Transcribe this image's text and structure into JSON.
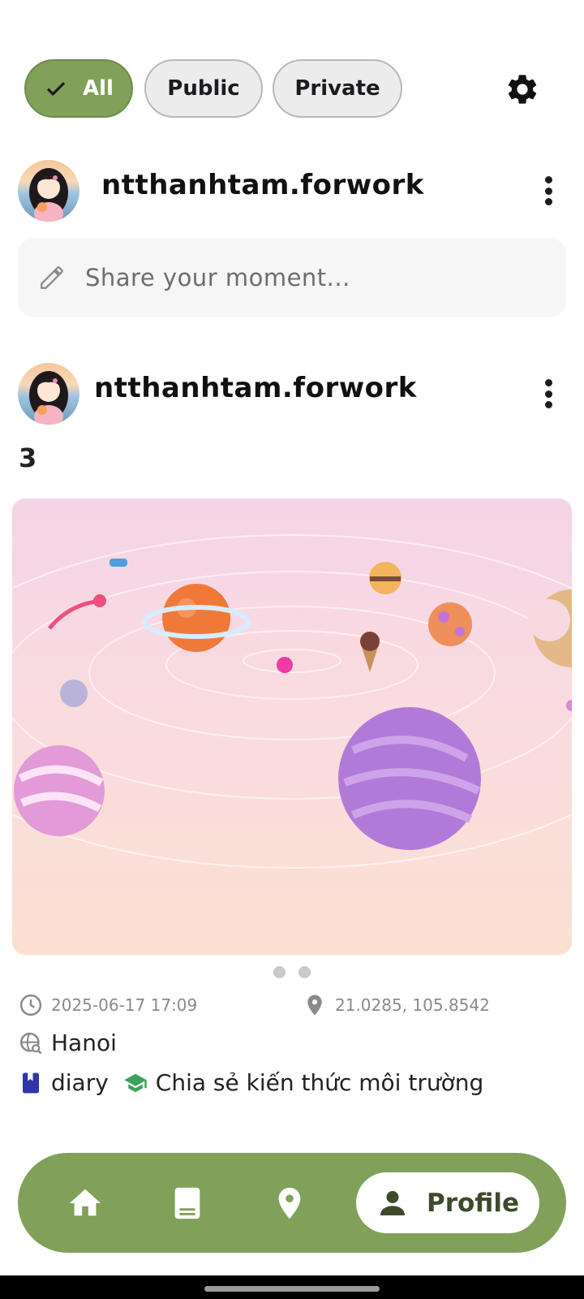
{
  "filters": {
    "all_label": "All",
    "public_label": "Public",
    "private_label": "Private"
  },
  "composer": {
    "username": "ntthanhtam.forwork",
    "placeholder": "Share your moment..."
  },
  "post": {
    "username": "ntthanhtam.forwork",
    "text": "3",
    "image_pages": 2,
    "active_page": 1,
    "datetime": "2025-06-17 17:09",
    "coordinates": "21.0285, 105.8542",
    "location": "Hanoi",
    "category": "diary",
    "topic": "Chia sẻ kiến thức môi trường"
  },
  "nav": {
    "items": [
      "home-icon",
      "book-icon",
      "location-pin-icon",
      "person-icon"
    ],
    "active_label": "Profile"
  },
  "colors": {
    "accent": "#81a05a",
    "diary_icon": "#2f35a8",
    "topic_icon": "#3aa45a"
  }
}
